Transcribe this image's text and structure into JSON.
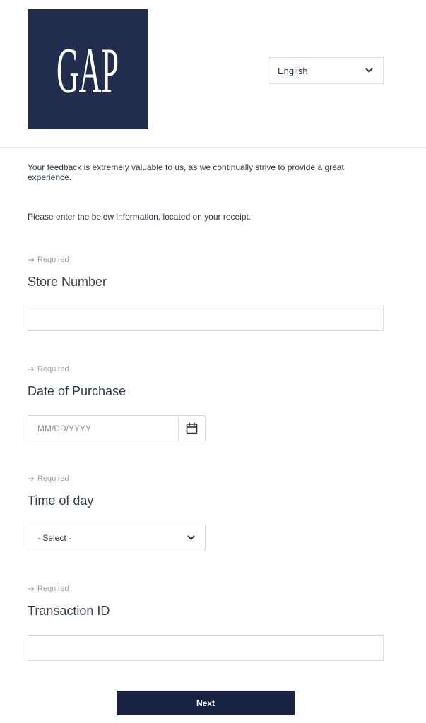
{
  "brand": {
    "logo_text": "GAP",
    "logo_bg": "#222d4e"
  },
  "language": {
    "selected": "English",
    "icon": "chevron-down-icon"
  },
  "intro_text": "Your feedback is extremely valuable to us, as we continually strive to provide a great experience.",
  "instruction_text": "Please enter the below information, located on your receipt.",
  "fields": {
    "store_number": {
      "required": "Required",
      "label": "Store Number",
      "value": "",
      "placeholder": ""
    },
    "date_of_purchase": {
      "required": "Required",
      "label": "Date of Purchase",
      "value": "",
      "placeholder": "MM/DD/YYYY",
      "icon": "calendar-icon"
    },
    "time_of_day": {
      "required": "Required",
      "label": "Time of day",
      "selected": "- Select -",
      "icon": "chevron-down-icon"
    },
    "transaction_id": {
      "required": "Required",
      "label": "Transaction ID",
      "value": "",
      "placeholder": ""
    }
  },
  "next_button": {
    "label": "Next",
    "color": "#172340"
  },
  "colors": {
    "text": "#333e48",
    "muted": "#9aa1aa",
    "border": "#dadde2"
  }
}
